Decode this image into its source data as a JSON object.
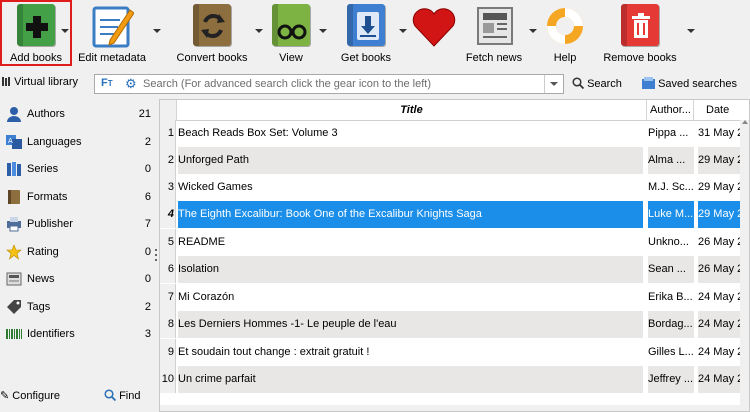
{
  "toolbar": {
    "add_books": "Add books",
    "edit_metadata": "Edit metadata",
    "convert_books": "Convert books",
    "view": "View",
    "get_books": "Get books",
    "fetch_news": "Fetch news",
    "help": "Help",
    "remove_books": "Remove books"
  },
  "searchbar": {
    "virtual_library": "Virtual library",
    "placeholder": "Search (For advanced search click the gear icon to the left)",
    "search_label": "Search",
    "saved_searches_label": "Saved searches"
  },
  "sidebar": {
    "items": [
      {
        "label": "Authors",
        "count": "21"
      },
      {
        "label": "Languages",
        "count": "2"
      },
      {
        "label": "Series",
        "count": "0"
      },
      {
        "label": "Formats",
        "count": "6"
      },
      {
        "label": "Publisher",
        "count": "7"
      },
      {
        "label": "Rating",
        "count": "0"
      },
      {
        "label": "News",
        "count": "0"
      },
      {
        "label": "Tags",
        "count": "2"
      },
      {
        "label": "Identifiers",
        "count": "3"
      }
    ],
    "configure": "Configure",
    "find": "Find"
  },
  "table": {
    "headers": {
      "title": "Title",
      "author": "Author...",
      "date": "Date"
    },
    "rows": [
      {
        "n": "1",
        "title": "Beach Reads Box Set: Volume 3",
        "author": "Pippa ...",
        "date": "31 May 2"
      },
      {
        "n": "2",
        "title": "Unforged Path",
        "author": "Alma ...",
        "date": "29 May 2"
      },
      {
        "n": "3",
        "title": "Wicked Games",
        "author": "M.J. Sc...",
        "date": "29 May 2"
      },
      {
        "n": "4",
        "title": "The Eighth Excalibur: Book One of the Excalibur Knights Saga",
        "author": "Luke M...",
        "date": "29 May 2"
      },
      {
        "n": "5",
        "title": "README",
        "author": "Unkno...",
        "date": "26 May 2"
      },
      {
        "n": "6",
        "title": "Isolation",
        "author": "Sean ...",
        "date": "26 May 2"
      },
      {
        "n": "7",
        "title": "Mi Corazón",
        "author": "Erika B...",
        "date": "24 May 2"
      },
      {
        "n": "8",
        "title": "Les Derniers Hommes -1- Le peuple de l'eau",
        "author": "Bordag...",
        "date": "24 May 2"
      },
      {
        "n": "9",
        "title": "Et soudain tout change : extrait gratuit !",
        "author": "Gilles L...",
        "date": "24 May 2"
      },
      {
        "n": "10",
        "title": "Un crime parfait",
        "author": "Jeffrey ...",
        "date": "24 May 2"
      }
    ]
  }
}
